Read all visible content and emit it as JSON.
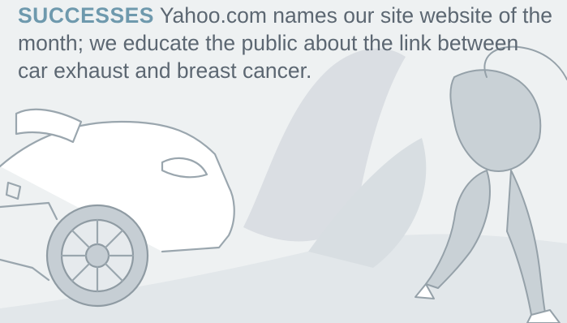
{
  "caption": {
    "heading": "SUCCESSES",
    "body": " Yahoo.com names our site website of the month; we educate the public about the link between car exhaust and breast cancer."
  },
  "colors": {
    "heading": "#6e99ad",
    "body_text": "#5c6772",
    "background": "#eef1f2",
    "illustration": "#c9d1d6"
  }
}
